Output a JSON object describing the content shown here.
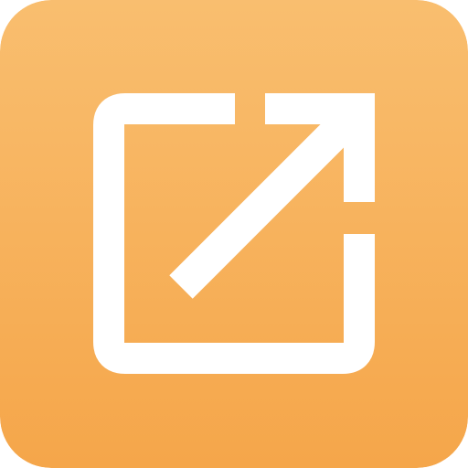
{
  "icon": {
    "name": "external-link-icon",
    "colors": {
      "background_top": "#F9BE6F",
      "background_bottom": "#F5A64A",
      "glyph": "#FFFFFF"
    }
  }
}
